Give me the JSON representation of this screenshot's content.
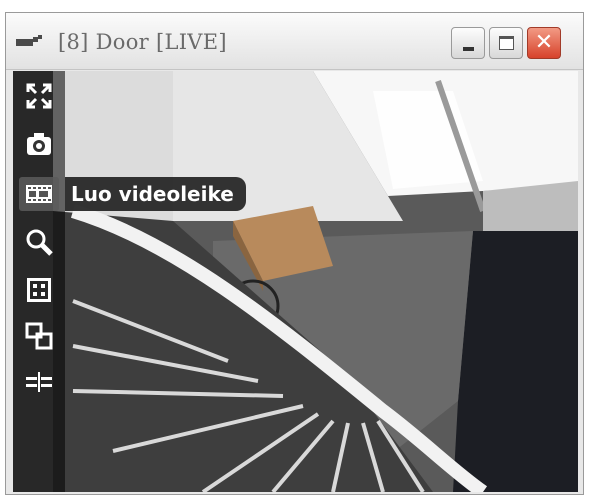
{
  "window": {
    "title": "[8] Door [LIVE]"
  },
  "window_controls": {
    "close_glyph": "✕"
  },
  "toolbar": {
    "items": [
      {
        "icon": "fullscreen-icon"
      },
      {
        "icon": "camera-icon"
      },
      {
        "icon": "film-strip-icon",
        "tooltip": "Luo videoleike",
        "active": true
      },
      {
        "icon": "zoom-icon"
      },
      {
        "icon": "grid-icon"
      },
      {
        "icon": "layers-icon"
      },
      {
        "icon": "split-icon"
      }
    ]
  },
  "colors": {
    "close_button": "#d7422b",
    "toolbar_overlay": "#000000"
  }
}
